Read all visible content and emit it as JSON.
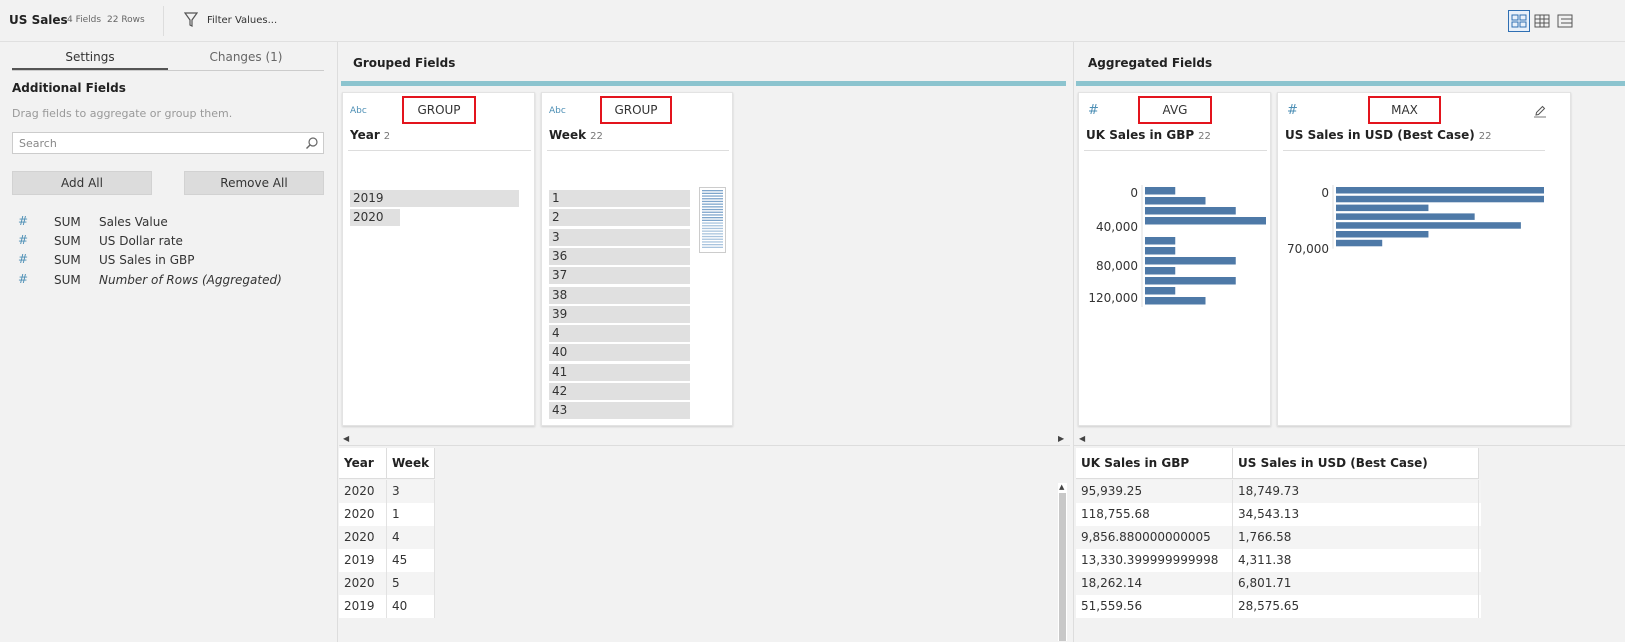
{
  "header": {
    "title": "US Sales",
    "fields_count": "4 Fields",
    "rows_count": "22 Rows",
    "filter_label": "Filter Values..."
  },
  "left_panel": {
    "tabs": [
      {
        "label": "Settings",
        "active": true
      },
      {
        "label": "Changes (1)",
        "active": false
      }
    ],
    "additional_fields_title": "Additional Fields",
    "hint": "Drag fields to aggregate or group them.",
    "search_placeholder": "Search",
    "add_all": "Add All",
    "remove_all": "Remove All",
    "fields": [
      {
        "agg": "SUM",
        "name": "Sales Value"
      },
      {
        "agg": "SUM",
        "name": "US Dollar rate"
      },
      {
        "agg": "SUM",
        "name": "US Sales in GBP"
      },
      {
        "agg": "SUM",
        "name": "Number of Rows (Aggregated)"
      }
    ]
  },
  "grouped": {
    "title": "Grouped Fields",
    "cards": [
      {
        "type": "Abc",
        "agg": "GROUP",
        "name": "Year",
        "count": "2",
        "values": [
          "2019",
          "2020"
        ]
      },
      {
        "type": "Abc",
        "agg": "GROUP",
        "name": "Week",
        "count": "22",
        "values": [
          "1",
          "2",
          "3",
          "36",
          "37",
          "38",
          "39",
          "4",
          "40",
          "41",
          "42",
          "43"
        ]
      }
    ],
    "table": {
      "headers": [
        "Year",
        "Week"
      ],
      "rows": [
        [
          "2020",
          "3"
        ],
        [
          "2020",
          "1"
        ],
        [
          "2020",
          "4"
        ],
        [
          "2019",
          "45"
        ],
        [
          "2020",
          "5"
        ],
        [
          "2019",
          "40"
        ]
      ]
    }
  },
  "aggregated": {
    "title": "Aggregated Fields",
    "cards": [
      {
        "type": "#",
        "agg": "AVG",
        "name": "UK Sales in GBP",
        "count": "22",
        "ticks": [
          "0",
          "40,000",
          "80,000",
          "120,000"
        ]
      },
      {
        "type": "#",
        "agg": "MAX",
        "name": "US Sales in USD (Best Case)",
        "count": "22",
        "ticks": [
          "0",
          "70,000"
        ]
      }
    ],
    "table": {
      "headers": [
        "UK Sales in GBP",
        "US Sales in USD (Best Case)"
      ],
      "rows": [
        [
          "95,939.25",
          "18,749.73"
        ],
        [
          "118,755.68",
          "34,543.13"
        ],
        [
          "9,856.880000000005",
          "1,766.58"
        ],
        [
          "13,330.399999999998",
          "4,311.38"
        ],
        [
          "18,262.14",
          "6,801.71"
        ],
        [
          "51,559.56",
          "28,575.65"
        ]
      ]
    }
  },
  "colors": {
    "accent_bar": "#8cc4cf",
    "highlight_border": "#e3141d",
    "histogram_bar": "#4e79a7",
    "type_icon": "#4d8fb5"
  },
  "chart_data": [
    {
      "type": "bar",
      "title": "UK Sales in GBP",
      "y_ticks": [
        "0",
        "40,000",
        "80,000",
        "120,000"
      ],
      "bin_counts": [
        3,
        6,
        9,
        12,
        0,
        3,
        3,
        9,
        3,
        9,
        3,
        6
      ]
    },
    {
      "type": "bar",
      "title": "US Sales in USD (Best Case)",
      "y_ticks": [
        "0",
        "70,000"
      ],
      "bin_counts": [
        9,
        9,
        4,
        6,
        8,
        4,
        2
      ]
    }
  ]
}
